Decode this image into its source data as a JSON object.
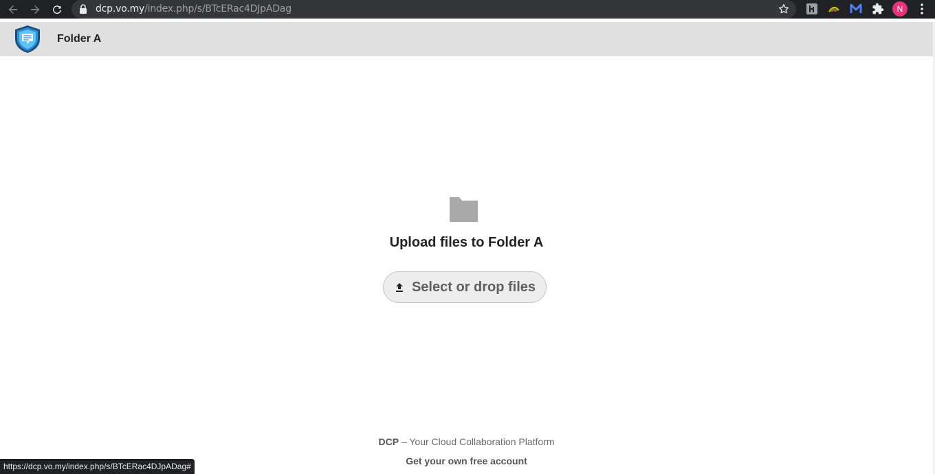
{
  "browser": {
    "url_host": "dcp.vo.my",
    "url_path": "/index.php/s/BTcERac4DJpADag",
    "avatar_letter": "N",
    "status_url": "https://dcp.vo.my/index.php/s/BTcERac4DJpADag#"
  },
  "header": {
    "title": "Folder A"
  },
  "main": {
    "upload_title": "Upload files to Folder A",
    "upload_button_label": "Select or drop files"
  },
  "footer": {
    "brand": "DCP",
    "tagline": " – Your Cloud Collaboration Platform",
    "signup_link": "Get your own free account"
  },
  "icons": {
    "back": "arrow-left-icon",
    "forward": "arrow-right-icon",
    "reload": "reload-icon",
    "lock": "lock-icon",
    "star": "star-icon",
    "extensions": "puzzle-icon",
    "menu": "kebab-menu-icon",
    "folder": "folder-icon",
    "upload": "upload-icon"
  },
  "colors": {
    "header_bg": "#e0e0e0",
    "avatar_bg": "#e8337a",
    "button_bg": "#ededed",
    "folder": "#a9a9a9"
  }
}
